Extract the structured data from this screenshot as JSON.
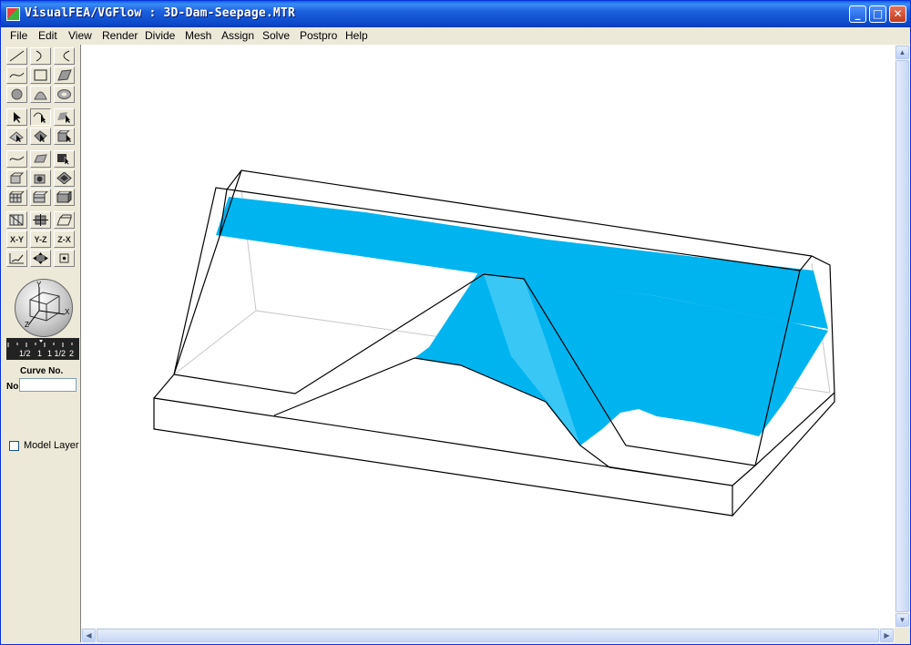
{
  "window": {
    "title": "VisualFEA/VGFlow :  3D-Dam-Seepage.MTR",
    "minimize_glyph": "_",
    "maximize_glyph": "□",
    "close_glyph": "✕"
  },
  "menu": {
    "items": [
      "File",
      "Edit",
      "View",
      "Render",
      "Divide",
      "Mesh",
      "Assign",
      "Solve",
      "Postpro",
      "Help"
    ]
  },
  "toolbox": {
    "tools": {
      "line": "line-tool-icon",
      "arc": "arc-tool-icon",
      "arc3": "arc3-tool-icon",
      "spline": "spline-tool-icon",
      "rect": "rect-tool-icon",
      "surface": "surface-tool-icon",
      "circle": "circle-tool-icon",
      "dome": "dome-tool-icon",
      "ring": "ring-tool-icon",
      "select_arrow": "select-arrow-icon",
      "select_curve": "select-curve-icon",
      "select_surface": "select-surface-icon",
      "select_edge": "select-edge-icon",
      "select_face": "select-face-icon",
      "select_solid": "select-solid-icon"
    },
    "view_labels": {
      "xy": "X-Y",
      "yz": "Y-Z",
      "zx": "Z-X"
    },
    "orientation_axes": {
      "x": "X",
      "y": "Y",
      "z": "Z"
    },
    "ruler_ticks": [
      "1/2",
      "1",
      "1 1/2",
      "2"
    ],
    "curve_label": "Curve No.",
    "no_label": "No",
    "no_value": "",
    "model_layer_label": "Model Layer",
    "model_layer_checked": false
  },
  "colors": {
    "accent_blue": "#00b4f0",
    "outline": "#000000"
  }
}
